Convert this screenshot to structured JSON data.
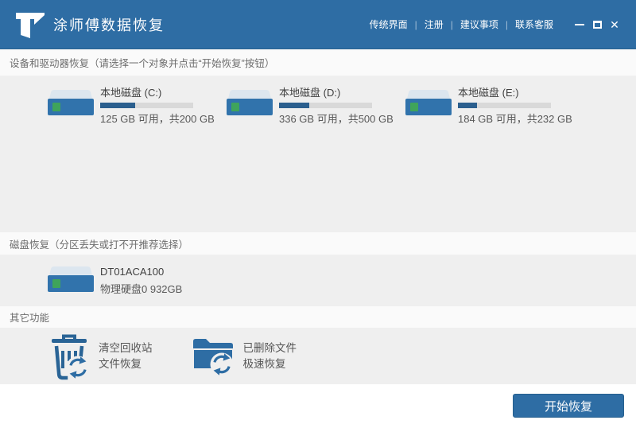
{
  "window": {
    "title": "涂师傅数据恢复",
    "nav_links": [
      "传统界面",
      "注册",
      "建议事项",
      "联系客服"
    ],
    "controls": {
      "minimize": "—",
      "maximize": "□",
      "close": "✕"
    }
  },
  "sections": {
    "devices": {
      "label": "设备和驱动器恢复（请选择一个对象并点击“开始恢复”按钮）",
      "drives": [
        {
          "name": "本地磁盘  (C:)",
          "size_text": "125 GB 可用，共200 GB",
          "free_gb": 125,
          "total_gb": 200,
          "used_percent": 37.5
        },
        {
          "name": "本地磁盘  (D:)",
          "size_text": "336 GB 可用，共500 GB",
          "free_gb": 336,
          "total_gb": 500,
          "used_percent": 32.8
        },
        {
          "name": "本地磁盘  (E:)",
          "size_text": "184 GB 可用，共232 GB",
          "free_gb": 184,
          "total_gb": 232,
          "used_percent": 20.7
        }
      ]
    },
    "disk": {
      "label": "磁盘恢复（分区丢失或打不开推荐选择）",
      "drives": [
        {
          "name": "DT01ACA100",
          "size_text": "物理硬盘0 932GB"
        }
      ]
    },
    "other": {
      "label": "其它功能",
      "features": [
        {
          "icon": "recycle-bin-recover-icon",
          "line1": "清空回收站",
          "line2": "文件恢复"
        },
        {
          "icon": "deleted-files-recover-icon",
          "line1": "已删除文件",
          "line2": "极速恢复"
        }
      ]
    }
  },
  "footer": {
    "start_button": "开始恢复"
  },
  "icons": {
    "app-logo-icon": "white letter T ribbon",
    "drive-icon": "hard drive with green LED",
    "minimize-icon": "—",
    "maximize-icon": "□",
    "close-icon": "✕",
    "refresh-icon": "circular recovery arrows"
  },
  "colors": {
    "header_bg": "#2e6da4",
    "accent": "#2e6da4",
    "bar_fill": "#2b5f8e",
    "bar_track": "#d9d9d9",
    "panel_bg": "#efefef",
    "label_bg": "#fafafa",
    "led_green": "#3fa45b"
  }
}
